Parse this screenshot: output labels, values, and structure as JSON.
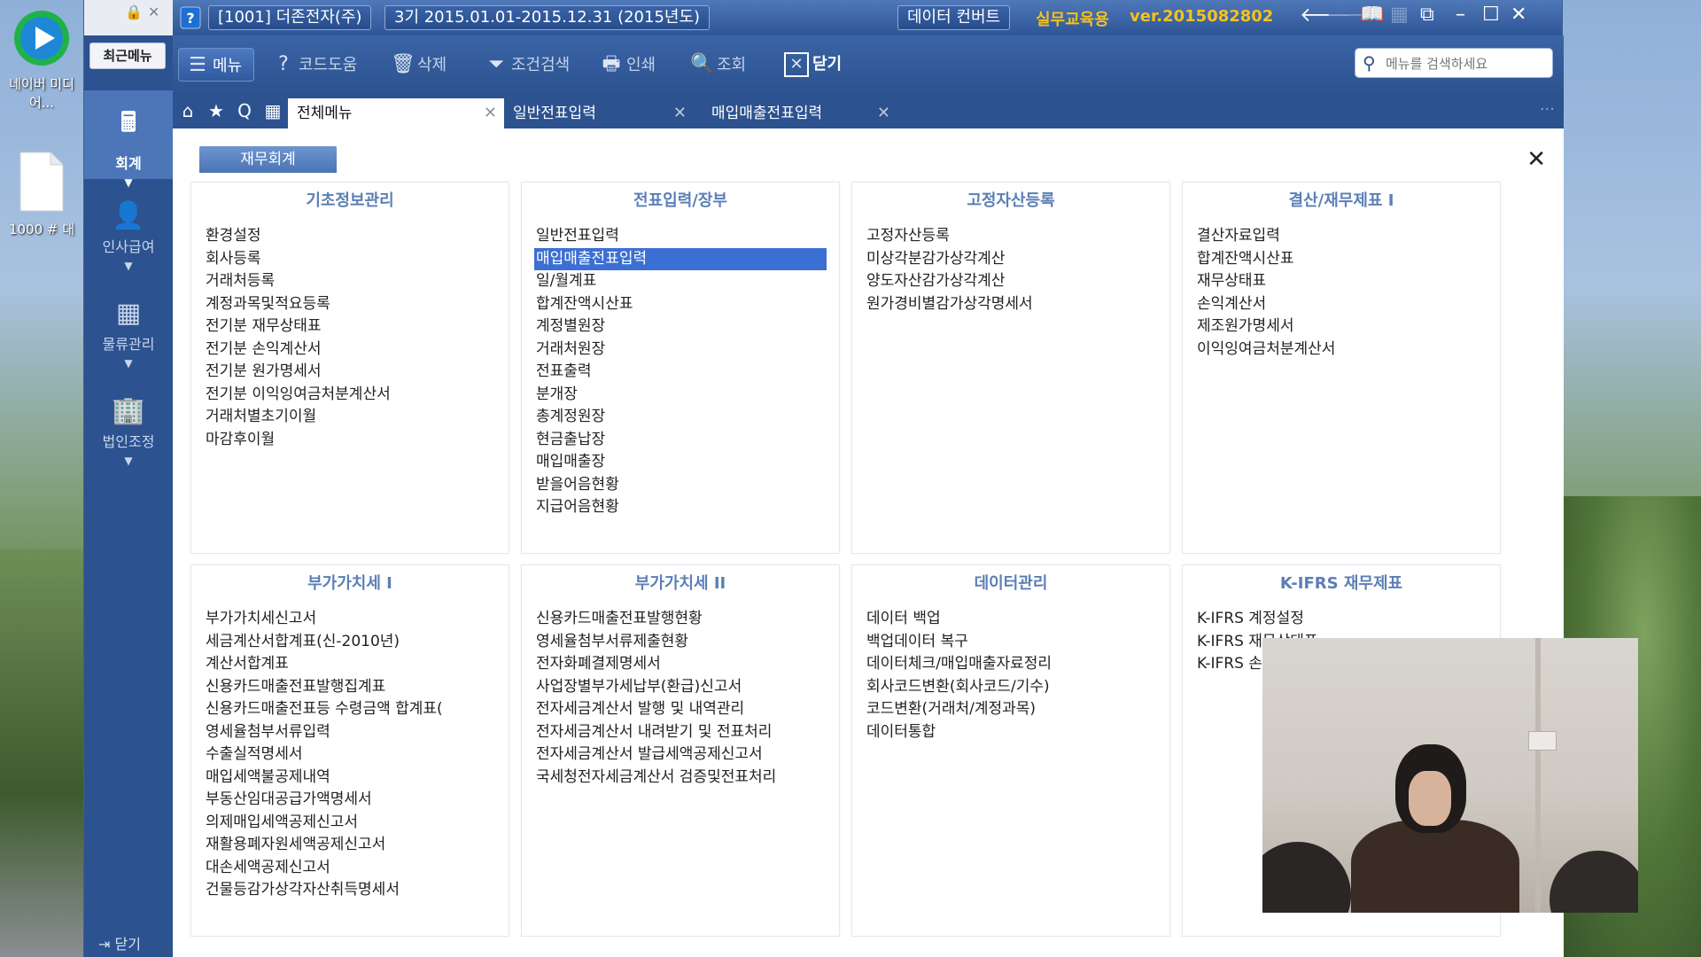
{
  "desktop": {
    "icon1_label": "네이버 미디어...",
    "icon2_label": "1000 # 대"
  },
  "titlebar": {
    "company": "[1001] 더존전자(주)",
    "period": "3기 2015.01.01-2015.12.31 (2015년도)",
    "data_convert": "데이터 컨버트",
    "edu_label": "실무교육용",
    "version": "ver.2015082802"
  },
  "sidebar": {
    "recent_menu": "최근메뉴",
    "items": [
      {
        "label": "회계"
      },
      {
        "label": "인사급여"
      },
      {
        "label": "물류관리"
      },
      {
        "label": "법인조정"
      }
    ],
    "close_label": "닫기"
  },
  "toolbar": {
    "menu": "메뉴",
    "code_help": "코드도움",
    "delete": "삭제",
    "filter": "조건검색",
    "print": "인쇄",
    "view": "조회",
    "close": "닫기",
    "search_placeholder": "메뉴를 검색하세요"
  },
  "tabs": [
    {
      "label": "전체메뉴"
    },
    {
      "label": "일반전표입력"
    },
    {
      "label": "매입매출전표입력"
    }
  ],
  "module_tab": "재무회계",
  "panels": [
    {
      "title": "기초정보관리",
      "items": [
        "환경설정",
        "회사등록",
        "거래처등록",
        "계정과목및적요등록",
        "전기분 재무상태표",
        "전기분 손익계산서",
        "전기분 원가명세서",
        "전기분 이익잉여금처분계산서",
        "거래처별초기이월",
        "마감후이월"
      ]
    },
    {
      "title": "전표입력/장부",
      "items": [
        "일반전표입력",
        "매입매출전표입력",
        "일/월계표",
        "합계잔액시산표",
        "계정별원장",
        "거래처원장",
        "전표출력",
        "분개장",
        "총계정원장",
        "현금출납장",
        "매입매출장",
        "받을어음현황",
        "지급어음현황"
      ]
    },
    {
      "title": "고정자산등록",
      "items": [
        "고정자산등록",
        "미상각분감가상각계산",
        "양도자산감가상각계산",
        "원가경비별감가상각명세서"
      ]
    },
    {
      "title": "결산/재무제표 I",
      "items": [
        "결산자료입력",
        "합계잔액시산표",
        "재무상태표",
        "손익계산서",
        "제조원가명세서",
        "이익잉여금처분계산서"
      ]
    },
    {
      "title": "부가가치세 I",
      "items": [
        "부가가치세신고서",
        "세금계산서합계표(신-2010년)",
        "계산서합계표",
        "신용카드매출전표발행집계표",
        "신용카드매출전표등 수령금액 합계표(",
        "영세율첨부서류입력",
        "수출실적명세서",
        "매입세액불공제내역",
        "부동산임대공급가액명세서",
        "의제매입세액공제신고서",
        "재활용폐자원세액공제신고서",
        "대손세액공제신고서",
        "건물등감가상각자산취득명세서"
      ]
    },
    {
      "title": "부가가치세 II",
      "items": [
        "신용카드매출전표발행현황",
        "영세율첨부서류제출현황",
        "전자화폐결제명세서",
        "사업장별부가세납부(환급)신고서",
        "전자세금계산서 발행 및 내역관리",
        "전자세금계산서 내려받기 및 전표처리",
        "전자세금계산서 발급세액공제신고서",
        "국세청전자세금계산서 검증및전표처리"
      ]
    },
    {
      "title": "데이터관리",
      "items": [
        "데이터 백업",
        "백업데이터 복구",
        "데이터체크/매입매출자료정리",
        "회사코드변환(회사코드/기수)",
        "코드변환(거래처/계정과목)",
        "데이터통합"
      ]
    },
    {
      "title": "K-IFRS 재무제표",
      "items": [
        "K-IFRS 계정설정",
        "K-IFRS 재무상태표",
        "K-IFRS 손익계산서"
      ]
    }
  ],
  "selected_item": "매입매출전표입력"
}
